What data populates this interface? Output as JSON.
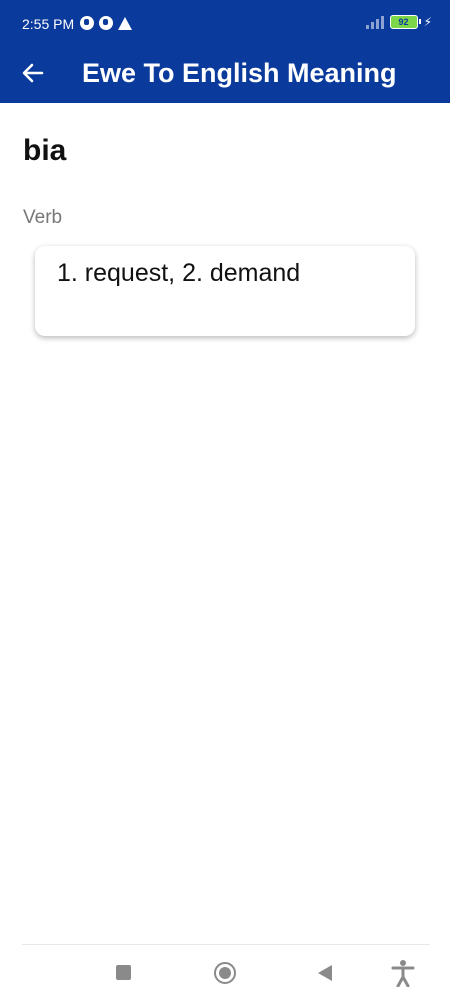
{
  "status": {
    "time": "2:55 PM",
    "battery": "92"
  },
  "app_bar": {
    "title": "Ewe To English Meaning",
    "back_icon": "arrow-left-icon"
  },
  "entry": {
    "word": "bia",
    "part_of_speech": "Verb",
    "meaning": "1. request, 2. demand"
  },
  "colors": {
    "primary": "#0a3a9c",
    "secondary_text": "#777777"
  },
  "nav": {
    "icons": [
      "recents-icon",
      "home-icon",
      "back-icon",
      "accessibility-icon"
    ]
  }
}
